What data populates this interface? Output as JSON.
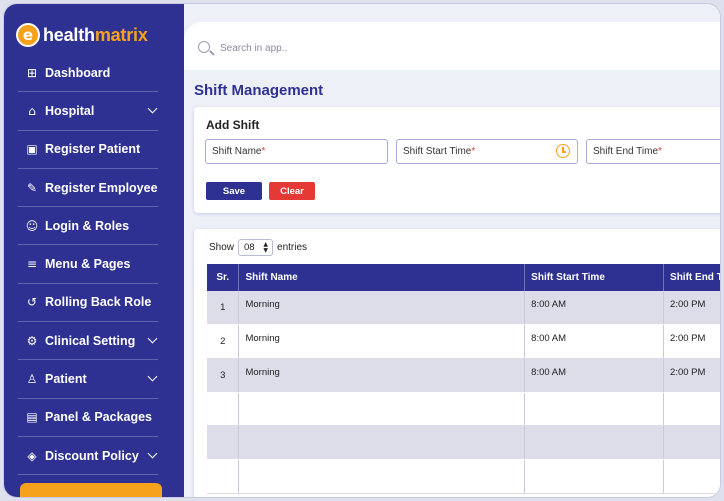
{
  "brand": {
    "letter": "e",
    "name_part1": "health",
    "name_part2": "matrix"
  },
  "sidebar": {
    "items": [
      {
        "label": "Dashboard",
        "icon": "grid-icon",
        "glyph": "⊞",
        "expandable": false
      },
      {
        "label": "Hospital",
        "icon": "bank-icon",
        "glyph": "⌂",
        "expandable": true
      },
      {
        "label": "Register Patient",
        "icon": "briefcase-icon",
        "glyph": "▣",
        "expandable": false
      },
      {
        "label": "Register Employee",
        "icon": "edit-icon",
        "glyph": "✎",
        "expandable": false
      },
      {
        "label": "Login & Roles",
        "icon": "users-icon",
        "glyph": "☺",
        "expandable": false
      },
      {
        "label": "Menu & Pages",
        "icon": "menu-icon",
        "glyph": "≡",
        "expandable": false
      },
      {
        "label": "Rolling Back Role",
        "icon": "undo-icon",
        "glyph": "↺",
        "expandable": false
      },
      {
        "label": "Clinical Setting",
        "icon": "gear-icon",
        "glyph": "⚙",
        "expandable": true
      },
      {
        "label": "Patient",
        "icon": "user-icon",
        "glyph": "♙",
        "expandable": true
      },
      {
        "label": "Panel & Packages",
        "icon": "package-icon",
        "glyph": "▤",
        "expandable": false
      },
      {
        "label": "Discount Policy",
        "icon": "tag-icon",
        "glyph": "◈",
        "expandable": true
      }
    ]
  },
  "search": {
    "placeholder": "Search in app.."
  },
  "page": {
    "title": "Shift Management"
  },
  "add_shift": {
    "title": "Add Shift",
    "fields": {
      "name": {
        "label": "Shift Name",
        "required": "*"
      },
      "start": {
        "label": "Shift Start Time",
        "required": "*"
      },
      "end": {
        "label": "Shift End Time",
        "required": "*"
      }
    },
    "save_label": "Save",
    "clear_label": "Clear"
  },
  "table": {
    "show_label": "Show",
    "entries_label": "entries",
    "page_size": "08",
    "columns": [
      "Sr.",
      "Shift Name",
      "Shift Start Time",
      "Shift End Ti"
    ],
    "rows": [
      [
        "1",
        "Morning",
        "8:00 AM",
        "2:00 PM"
      ],
      [
        "2",
        "Morning",
        "8:00 AM",
        "2:00 PM"
      ],
      [
        "3",
        "Morning",
        "8:00 AM",
        "2:00 PM"
      ],
      [
        "",
        "",
        "",
        ""
      ],
      [
        "",
        "",
        "",
        ""
      ],
      [
        "",
        "",
        "",
        ""
      ]
    ]
  },
  "colors": {
    "primary": "#2e3192",
    "accent": "#f6a21d",
    "danger": "#e53935"
  }
}
